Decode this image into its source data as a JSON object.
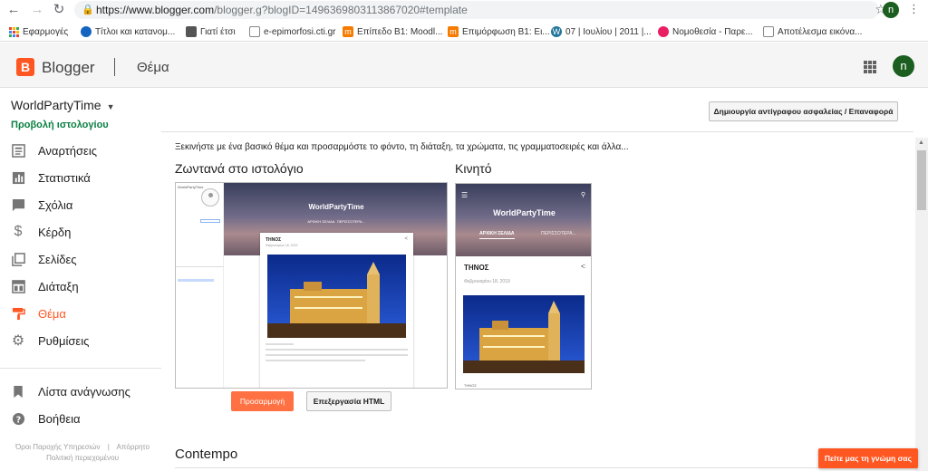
{
  "browser": {
    "url_main": "https://www.blogger.com",
    "url_rest": "/blogger.g?blogID=1496369803113867020#template",
    "profile_initial": "n",
    "bookmarks": [
      {
        "label": "Εφαρμογές",
        "icon": "apps-icon"
      },
      {
        "label": "Τίτλοι και κατανομ...",
        "icon": "blue-shield-icon"
      },
      {
        "label": "Γιατί έτσι",
        "icon": "image-icon"
      },
      {
        "label": "e-epimorfosi.cti.gr",
        "icon": "page-icon"
      },
      {
        "label": "Επίπεδο Β1: Moodl...",
        "icon": "moodle-icon"
      },
      {
        "label": "Επιμόρφωση Β1: Ει...",
        "icon": "moodle-icon"
      },
      {
        "label": "07 | Ιουλίου | 2011 |...",
        "icon": "wordpress-icon"
      },
      {
        "label": "Νομοθεσία - Παρε...",
        "icon": "flower-icon"
      },
      {
        "label": "Αποτέλεσμα εικόνα...",
        "icon": "page-icon"
      }
    ]
  },
  "header": {
    "logo_letter": "B",
    "app_name": "Blogger",
    "page_title": "Θέμα",
    "user_initial": "n"
  },
  "sidebar": {
    "blog_name": "WorldPartyTime",
    "view_blog": "Προβολή ιστολογίου",
    "items": [
      {
        "label": "Αναρτήσεις",
        "icon": "posts-icon",
        "active": false
      },
      {
        "label": "Στατιστικά",
        "icon": "stats-icon",
        "active": false
      },
      {
        "label": "Σχόλια",
        "icon": "comments-icon",
        "active": false
      },
      {
        "label": "Κέρδη",
        "icon": "dollar-icon",
        "active": false
      },
      {
        "label": "Σελίδες",
        "icon": "pages-icon",
        "active": false
      },
      {
        "label": "Διάταξη",
        "icon": "layout-icon",
        "active": false
      },
      {
        "label": "Θέμα",
        "icon": "paint-roller-icon",
        "active": true
      },
      {
        "label": "Ρυθμίσεις",
        "icon": "gear-icon",
        "active": false
      }
    ],
    "bottom_items": [
      {
        "label": "Λίστα ανάγνωσης",
        "icon": "bookmark-icon"
      },
      {
        "label": "Βοήθεια",
        "icon": "help-icon"
      }
    ],
    "footer": {
      "terms": "Όροι Παροχής Υπηρεσιών",
      "privacy": "Απόρρητο",
      "content_policy": "Πολιτική περιεχομένου"
    }
  },
  "main": {
    "backup_button": "Δημιουργία αντίγραφου ασφαλείας / Επαναφορά",
    "intro": "Ξεκινήστε με ένα βασικό θέμα και προσαρμόστε το φόντο, τη διάταξη, τα χρώματα, τις γραμματοσειρές και άλλα...",
    "live_title": "Ζωντανά στο ιστολόγιο",
    "mobile_title": "Κινητό",
    "customize_button": "Προσαρμογή",
    "edit_html_button": "Επεξεργασία HTML",
    "next_theme": "Contempo",
    "feedback_button": "Πείτε μας τη γνώμη σας"
  },
  "preview": {
    "blog_title": "WorldPartyTime",
    "post_title": "ΤΗΝΟΣ",
    "post_date": "Φεβρουαρίου 18, 2019",
    "tab_home": "ΑΡΧΙΚΗ ΣΕΛΙΔΑ",
    "tab_more": "ΠΕΡΙΣΣΟΤΕΡΑ...",
    "post_footer": "ΤΗΝΟΣ"
  },
  "colors": {
    "accent": "#ff5722",
    "view_blog_green": "#0b8043",
    "customize_button": "#ff7043"
  }
}
